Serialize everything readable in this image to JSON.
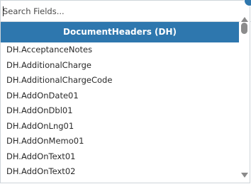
{
  "search": {
    "placeholder": "Search Fields...",
    "value": ""
  },
  "group": {
    "header": "DocumentHeaders (DH)",
    "items": [
      "DH.AcceptanceNotes",
      "DH.AdditionalCharge",
      "DH.AdditionalChargeCode",
      "DH.AddOnDate01",
      "DH.AddOnDbl01",
      "DH.AddOnLng01",
      "DH.AddOnMemo01",
      "DH.AddOnText01",
      "DH.AddOnText02"
    ]
  },
  "colors": {
    "header_bg": "#2e77ae",
    "header_text": "#ffffff",
    "scrollbar": "#8c8c8c"
  },
  "icons": {
    "corner": "close-icon",
    "scroll_up": "scroll-up-arrow-icon",
    "scroll_down": "scroll-down-arrow-icon"
  }
}
